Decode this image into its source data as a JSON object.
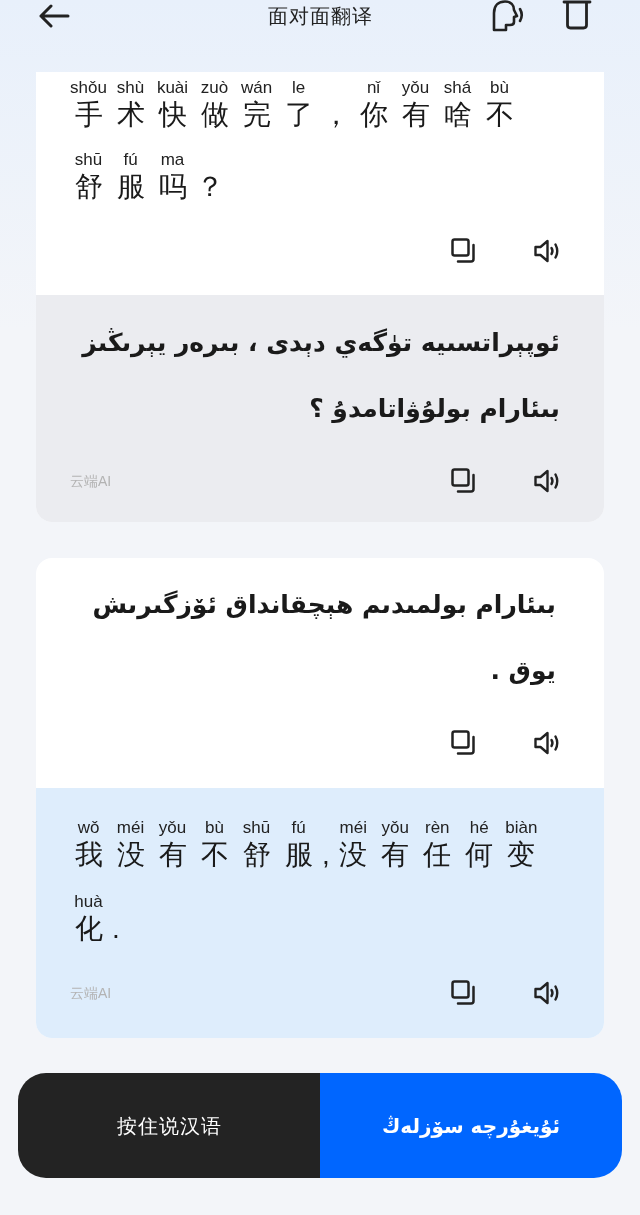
{
  "header": {
    "title": "面对面翻译"
  },
  "exchanges": [
    {
      "source": {
        "kind": "chinese",
        "lines": [
          [
            {
              "char": "手",
              "pinyin": "shǒu"
            },
            {
              "char": "术",
              "pinyin": "shù"
            },
            {
              "char": "快",
              "pinyin": "kuài"
            },
            {
              "char": "做",
              "pinyin": "zuò"
            },
            {
              "char": "完",
              "pinyin": "wán"
            },
            {
              "char": "了",
              "pinyin": "le"
            },
            {
              "char": "，"
            },
            {
              "char": "你",
              "pinyin": "nǐ"
            },
            {
              "char": "有",
              "pinyin": "yǒu"
            },
            {
              "char": "啥",
              "pinyin": "shá"
            },
            {
              "char": "不",
              "pinyin": "bù"
            }
          ],
          [
            {
              "char": "舒",
              "pinyin": "shū"
            },
            {
              "char": "服",
              "pinyin": "fú"
            },
            {
              "char": "吗",
              "pinyin": "ma"
            },
            {
              "char": "？"
            }
          ]
        ]
      },
      "translation": {
        "kind": "uyghur",
        "lines": [
          "ئوپېراتسىيە تۈگەي دېدى ، بىرەر يېرىڭىز",
          "بىئارام بولۇۋاتامدۇ ؟"
        ],
        "provider": "云端AI"
      }
    },
    {
      "source": {
        "kind": "uyghur",
        "lines": [
          "بىئارام بولمىدىم ھېچقانداق ئۆزگىرىش",
          "يوق ."
        ]
      },
      "translation": {
        "kind": "chinese",
        "lines": [
          [
            {
              "char": "我",
              "pinyin": "wǒ"
            },
            {
              "char": "没",
              "pinyin": "méi"
            },
            {
              "char": "有",
              "pinyin": "yǒu"
            },
            {
              "char": "不",
              "pinyin": "bù"
            },
            {
              "char": "舒",
              "pinyin": "shū"
            },
            {
              "char": "服",
              "pinyin": "fú"
            },
            {
              "char": ","
            },
            {
              "char": "没",
              "pinyin": "méi"
            },
            {
              "char": "有",
              "pinyin": "yǒu"
            },
            {
              "char": "任",
              "pinyin": "rèn"
            },
            {
              "char": "何",
              "pinyin": "hé"
            },
            {
              "char": "变",
              "pinyin": "biàn"
            }
          ],
          [
            {
              "char": "化",
              "pinyin": "huà"
            },
            {
              "char": "."
            }
          ]
        ],
        "provider": "云端AI"
      }
    }
  ],
  "talk_buttons": [
    {
      "kind": "chinese",
      "label": "按住说汉语"
    },
    {
      "kind": "uyghur",
      "label": "ئۇيغۇرچە سۆزلەڭ"
    }
  ]
}
